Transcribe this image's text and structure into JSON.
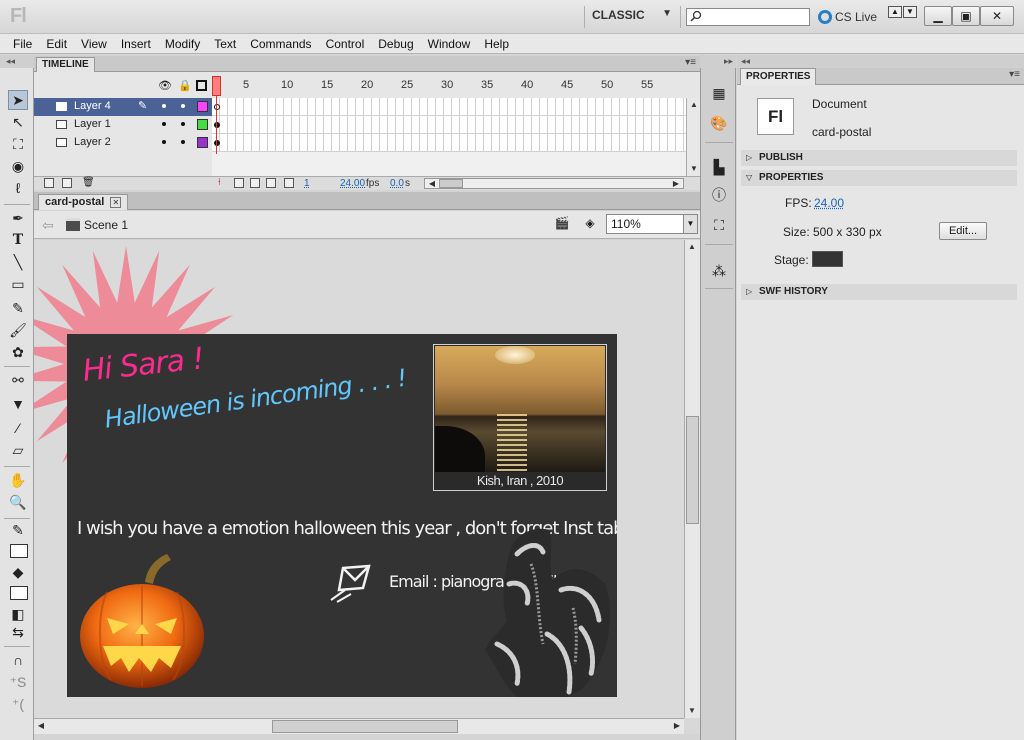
{
  "app": {
    "logo": "Fl"
  },
  "titlebar": {
    "workspace": "CLASSIC",
    "search_placeholder": "",
    "cs_live": "CS Live"
  },
  "menu": [
    "File",
    "Edit",
    "View",
    "Insert",
    "Modify",
    "Text",
    "Commands",
    "Control",
    "Debug",
    "Window",
    "Help"
  ],
  "timeline": {
    "tab": "TIMELINE",
    "frame_numbers": [
      "1",
      "5",
      "10",
      "15",
      "20",
      "25",
      "30",
      "35",
      "40",
      "45",
      "50",
      "55"
    ],
    "layers": [
      {
        "name": "Layer 4",
        "color": "#ff44ff",
        "selected": true
      },
      {
        "name": "Layer 1",
        "color": "#44dd44",
        "selected": false
      },
      {
        "name": "Layer 2",
        "color": "#9933cc",
        "selected": false
      }
    ],
    "current_frame": "1",
    "fps": "24.00",
    "fps_unit": "fps",
    "time": "0.0",
    "time_unit": "s"
  },
  "document": {
    "tab": "card-postal",
    "scene": "Scene 1",
    "zoom": "110%"
  },
  "stage": {
    "greeting": "Hi Sara !",
    "subtitle": "Halloween is incoming . . . !",
    "photo_caption": "Kish, Iran , 2010",
    "message": "I wish you have a emotion halloween this year , don't forget Inst      tables.com !",
    "email": "Email : pianogrand        mail.com",
    "colors": {
      "stage": "#333333",
      "greeting": "#ff2b8e",
      "subtitle": "#62c6ff",
      "burst": "#f07c8c"
    }
  },
  "properties": {
    "tab": "PROPERTIES",
    "doc_type": "Document",
    "doc_name": "card-postal",
    "sections": {
      "publish": "PUBLISH",
      "properties": "PROPERTIES",
      "swf_history": "SWF HISTORY"
    },
    "fps_label": "FPS:",
    "fps_value": "24.00",
    "size_label": "Size:",
    "size_value": "500 x 330 px",
    "edit_button": "Edit...",
    "stage_label": "Stage:",
    "stage_color": "#333333"
  }
}
